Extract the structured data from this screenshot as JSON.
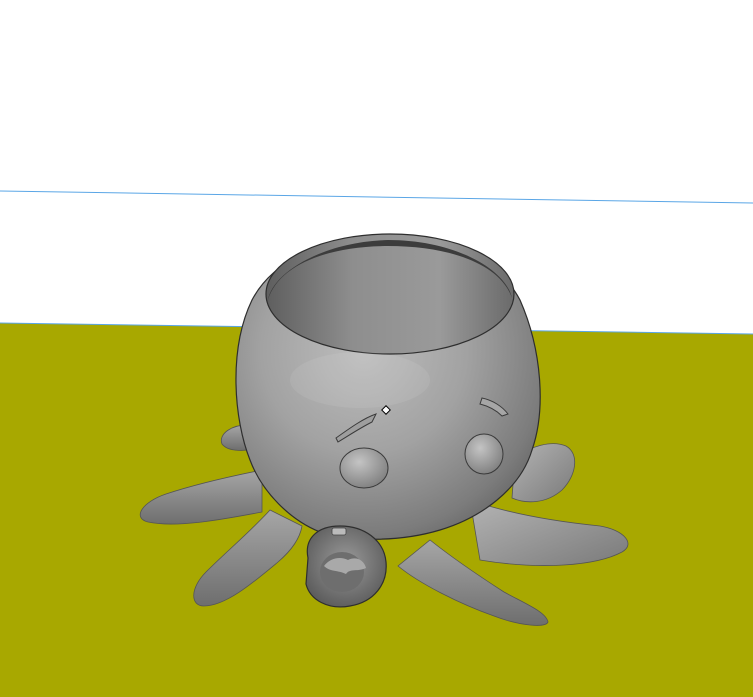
{
  "viewport": {
    "background_color": "#ffffff",
    "ground_color": "#a8a800",
    "horizon_line_color": "#5aa6e6"
  },
  "model": {
    "subject": "octopus planter",
    "base_color": "#8c8c8c",
    "highlight_color": "#b0b0b0",
    "shadow_color": "#4a4a4a",
    "rim_color": "#2e2e2e"
  },
  "cursor": {
    "icon": "vertex-marker-icon"
  }
}
